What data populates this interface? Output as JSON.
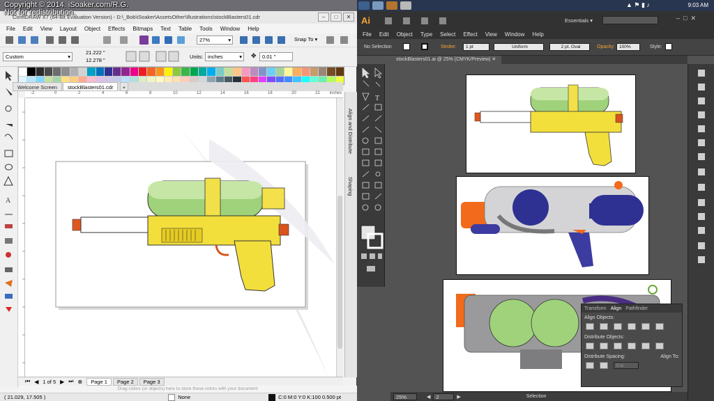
{
  "watermark": {
    "line1": "Copyright © 2014. iSoaker.com/R.G.",
    "line2": "Not for redistribution."
  },
  "taskbar": {
    "clock": "9:03 AM"
  },
  "coreldraw": {
    "title": "CorelDRAW X7 (64-Bit Evaluation Version) - D:\\_Bob\\iSoaker\\AssetsOther\\Illustrations\\stockBlasters01.cdr",
    "menu": [
      "File",
      "Edit",
      "View",
      "Layout",
      "Object",
      "Effects",
      "Bitmaps",
      "Text",
      "Table",
      "Tools",
      "Window",
      "Help"
    ],
    "zoom": "27%",
    "snap_to": "Snap To",
    "page_size": "Custom",
    "width": "21.222 \"",
    "height": "12.278 \"",
    "units_label": "Units:",
    "units_value": "inches",
    "nudge": "0.01 \"",
    "tabs": [
      "Welcome Screen",
      "stockBlasters01.cdr"
    ],
    "ruler_ticks": [
      "-2",
      "0",
      "2",
      "4",
      "6",
      "8",
      "10",
      "12",
      "14",
      "16",
      "18",
      "20",
      "22"
    ],
    "ruler_unit": "inches",
    "docker_tabs": [
      "Align and Distribute",
      "Shaping"
    ],
    "page_counter": "1 of 5",
    "pages": [
      "Page 1",
      "Page 2",
      "Page 3"
    ],
    "hint": "Drag colors (or objects) here to store these colors with your document",
    "status_coords": "( 21.029, 17.505 )",
    "status_fill": "None",
    "status_color": "C:0 M:0 Y:0 K:100  0.500 pt",
    "palette": [
      "#ffffff",
      "#000000",
      "#2b2b2b",
      "#4a4a4a",
      "#6d6d6d",
      "#8f8f8f",
      "#b1b1b1",
      "#d2d2d2",
      "#00a0c6",
      "#0072bc",
      "#2e3192",
      "#662d91",
      "#92278f",
      "#ec008c",
      "#ed1c24",
      "#f26522",
      "#f7941d",
      "#fff200",
      "#8dc63f",
      "#39b54a",
      "#00a651",
      "#00a99d",
      "#00aeef",
      "#7accc8",
      "#c4df9b",
      "#fdc689",
      "#f49ac1",
      "#bd8cbf",
      "#8393ca",
      "#6dcff6",
      "#a3d39c",
      "#fff799",
      "#fbaf5d",
      "#f69679",
      "#c69c6d",
      "#998675",
      "#754c24",
      "#603913",
      "#e1f5fe",
      "#b3e5fc",
      "#80d8ff",
      "#c5e1a5",
      "#a5d6a7",
      "#ffe082",
      "#ffcc80",
      "#ffab91",
      "#f8bbd0",
      "#e1bee7",
      "#d1c4e9",
      "#c5cae9",
      "#bbdefb",
      "#b2dfdb",
      "#dcedc8",
      "#f0f4c3",
      "#fff9c4",
      "#ffecb3",
      "#ffe0b2",
      "#ffccbc",
      "#d7ccc8",
      "#cfd8dc",
      "#90a4ae",
      "#607d8b",
      "#455a64",
      "#263238",
      "#ff5252",
      "#ff4081",
      "#e040fb",
      "#7c4dff",
      "#536dfe",
      "#448aff",
      "#40c4ff",
      "#18ffff",
      "#64ffda",
      "#69f0ae",
      "#b2ff59",
      "#eeff41"
    ]
  },
  "illustrator": {
    "logo": "Ai",
    "workspace": "Essentials",
    "menu": [
      "File",
      "Edit",
      "Object",
      "Type",
      "Select",
      "Effect",
      "View",
      "Window",
      "Help"
    ],
    "selection": "No Selection",
    "stroke_label": "Stroke:",
    "stroke_value": "1 pt",
    "profile": "Uniform",
    "brush": "2 pt. Oval",
    "opacity_label": "Opacity:",
    "opacity_value": "100%",
    "style_label": "Style:",
    "doc_tab": "stockBlasters01.ai @ 25% (CMYK/Preview)",
    "status_zoom": "25%",
    "status_artboard": "2",
    "status_tool": "Selection",
    "align_panel": {
      "tabs": [
        "Transform",
        "Align",
        "Pathfinder"
      ],
      "align_objects": "Align Objects:",
      "distribute_objects": "Distribute Objects:",
      "distribute_spacing": "Distribute Spacing:",
      "align_to": "Align To:",
      "spacing_value": "0 in"
    }
  }
}
